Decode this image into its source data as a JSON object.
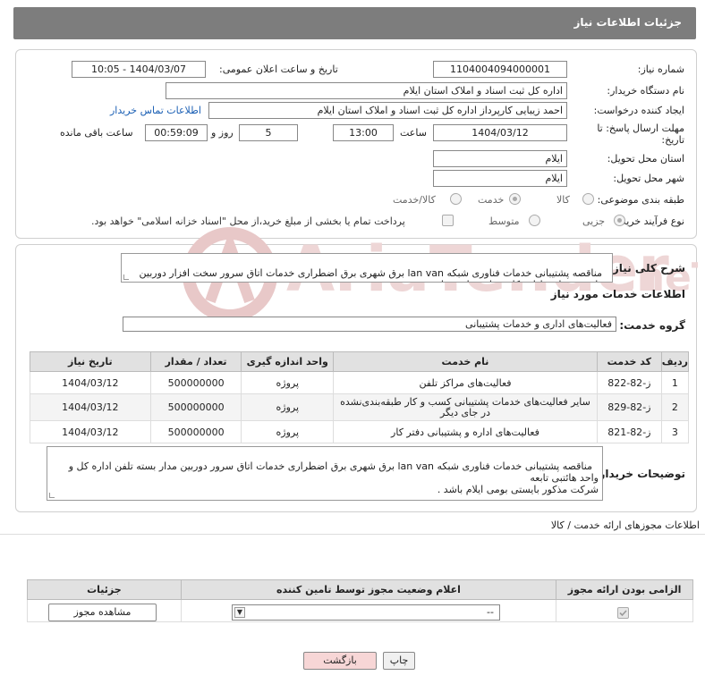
{
  "header": {
    "title": "جزئیات اطلاعات نیاز"
  },
  "form": {
    "need_number_label": "شماره نیاز:",
    "need_number": "1104004094000001",
    "announce_label": "تاریخ و ساعت اعلان عمومی:",
    "announce_value": "1404/03/07 - 10:05",
    "buyer_org_label": "نام دستگاه خریدار:",
    "buyer_org": "اداره کل ثبت اسناد و املاک استان ایلام",
    "requester_label": "ایجاد کننده درخواست:",
    "requester": "احمد زیبایی کارپرداز اداره کل ثبت اسناد و املاک استان ایلام",
    "contact_link": "اطلاعات تماس خریدار",
    "deadline_label": "مهلت ارسال پاسخ: تا تاریخ:",
    "deadline_date": "1404/03/12",
    "time_label": "ساعت",
    "deadline_time": "13:00",
    "days_value": "5",
    "days_label": "روز و",
    "remaining_time": "00:59:09",
    "remaining_label": "ساعت باقی مانده",
    "province_label": "استان محل تحویل:",
    "province": "ایلام",
    "city_label": "شهر محل تحویل:",
    "city": "ایلام",
    "category_label": "طبقه بندی موضوعی:",
    "category_options": [
      "کالا",
      "خدمت",
      "کالا/خدمت"
    ],
    "process_label": "نوع فرآیند خرید :",
    "process_options": [
      "جزیی",
      "متوسط"
    ],
    "payment_note": "پرداخت تمام یا بخشی از مبلغ خرید،از محل \"اسناد خزانه اسلامی\" خواهد بود."
  },
  "summary": {
    "label": "شرح کلی نیاز:",
    "text": "مناقصه پشتیبانی خدمات فناوری شبکه lan van برق شهری برق اضطراری خدمات اتاق سرور سخت افزار دوربین مدار بسته تلفن اداره کل و واحد هائتبی تابعه"
  },
  "services": {
    "section_title": "اطلاعات خدمات مورد نیاز",
    "group_label": "گروه خدمت:",
    "group_value": "فعالیت‌های اداری و خدمات پشتیبانی",
    "columns": [
      "ردیف",
      "کد خدمت",
      "نام خدمت",
      "واحد اندازه گیری",
      "تعداد / مقدار",
      "تاریخ نیاز"
    ],
    "rows": [
      {
        "idx": "1",
        "code": "ز-82-822",
        "name": "فعالیت‌های مراکز تلفن",
        "unit": "پروژه",
        "qty": "500000000",
        "date": "1404/03/12"
      },
      {
        "idx": "2",
        "code": "ز-82-829",
        "name": "سایر فعالیت‌های خدمات پشتیبانی کسب و کار طبقه‌بندی‌نشده در جای دیگر",
        "unit": "پروژه",
        "qty": "500000000",
        "date": "1404/03/12"
      },
      {
        "idx": "3",
        "code": "ز-82-821",
        "name": "فعالیت‌های اداره و پشتیبانی دفتر کار",
        "unit": "پروژه",
        "qty": "500000000",
        "date": "1404/03/12"
      }
    ]
  },
  "buyer_notes": {
    "label": "توضیحات خریدار:",
    "text": "مناقصه پشتیبانی خدمات فناوری شبکه lan van برق شهری برق اضطراری خدمات اتاق سرور دوربین مدار بسته تلفن اداره کل و واحد هائتبی تابعه\nشرکت مذکور بایستی بومی ایلام باشد ."
  },
  "permits": {
    "section_title": "اطلاعات مجوزهای ارائه خدمت / کالا",
    "columns": [
      "الزامی بودن ارائه مجوز",
      "اعلام وضعیت مجوز توسط تامین کننده",
      "جزئیات"
    ],
    "select_value": "--",
    "view_button": "مشاهده مجوز"
  },
  "footer": {
    "print_button": "چاپ",
    "back_button": "بازگشت"
  },
  "colors": {
    "header_bg": "#7d7d7d",
    "link": "#1a5fb4",
    "watermark": "#e8c8c8"
  }
}
